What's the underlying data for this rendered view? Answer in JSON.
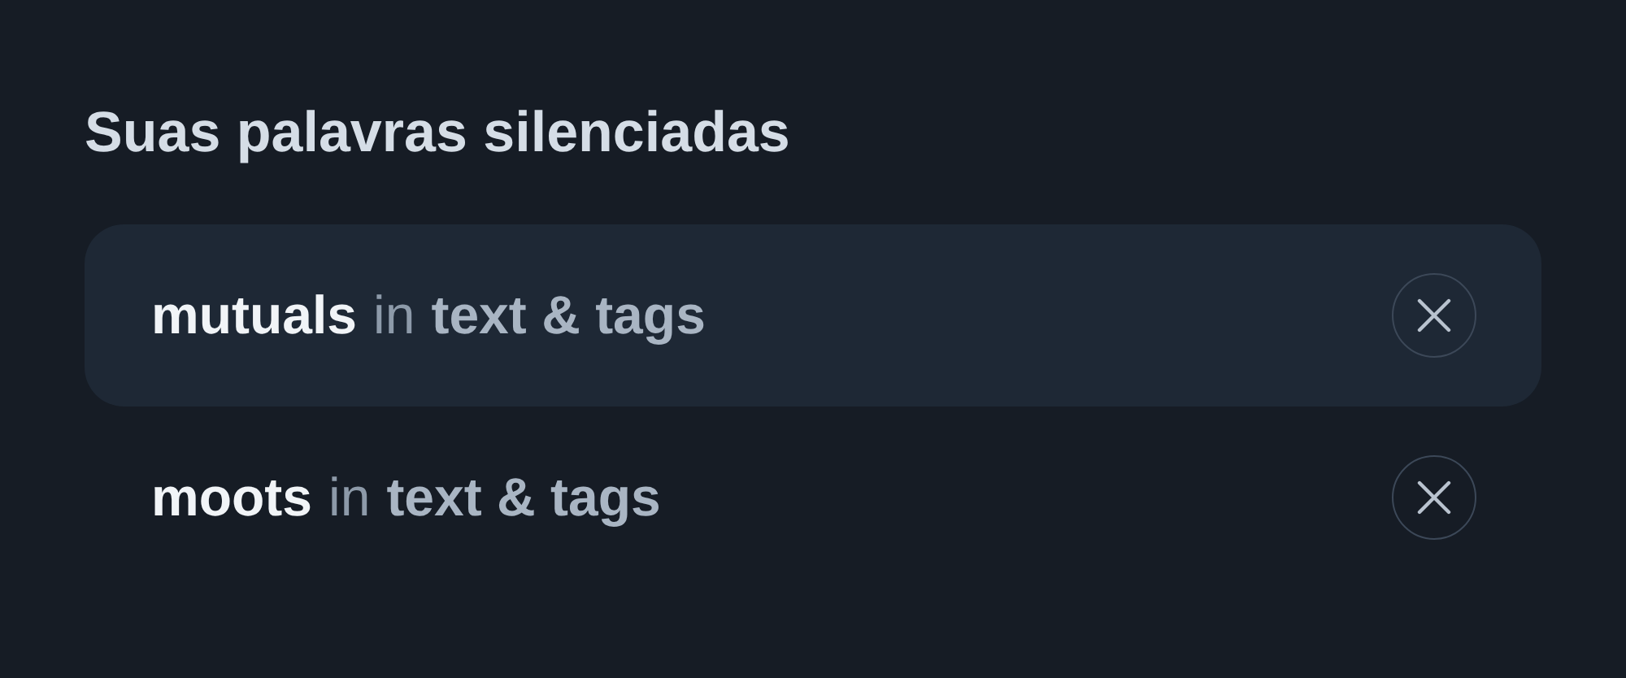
{
  "title": "Suas palavras silenciadas",
  "muted_words": [
    {
      "word": "mutuals",
      "connector": "in",
      "scope": "text & tags",
      "highlighted": true
    },
    {
      "word": "moots",
      "connector": "in",
      "scope": "text & tags",
      "highlighted": false
    }
  ]
}
